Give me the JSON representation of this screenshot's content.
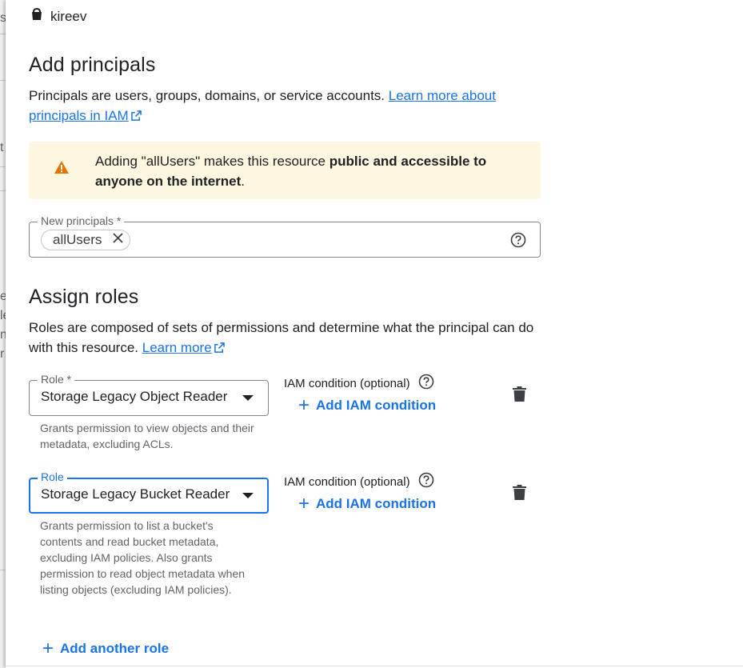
{
  "backdrop": {
    "fragments": [
      "s",
      "t",
      "e",
      "le",
      "n",
      "r"
    ]
  },
  "resource": {
    "icon": "bucket-icon",
    "name": "kireev"
  },
  "principals": {
    "title": "Add principals",
    "description": "Principals are users, groups, domains, or service accounts.",
    "learn_more_label": "Learn more about principals in IAM",
    "warning": {
      "icon": "warning-icon",
      "text_prefix": "Adding \"allUsers\" makes this resource ",
      "text_bold": "public and accessible to anyone on the internet",
      "text_suffix": "."
    },
    "new_principals_label": "New principals *",
    "chips": [
      "allUsers"
    ],
    "help_icon": "help-icon"
  },
  "roles": {
    "title": "Assign roles",
    "description": "Roles are composed of sets of permissions and determine what the principal can do with this resource.",
    "learn_more_label": "Learn more",
    "items": [
      {
        "label": "Role *",
        "value": "Storage Legacy Object Reader",
        "description": "Grants permission to view objects and their metadata, excluding ACLs.",
        "condition_label": "IAM condition (optional)",
        "add_condition_label": "Add IAM condition"
      },
      {
        "label": "Role",
        "value": "Storage Legacy Bucket Reader",
        "description": "Grants permission to list a bucket's contents and read bucket metadata, excluding IAM policies. Also grants permission to read object metadata when listing objects (excluding IAM policies).",
        "condition_label": "IAM condition (optional)",
        "add_condition_label": "Add IAM condition"
      }
    ],
    "add_another_label": "Add another role"
  },
  "colors": {
    "accent": "#1a73e8",
    "warning_bg": "#fef7e0",
    "warning_icon": "#e37400"
  }
}
